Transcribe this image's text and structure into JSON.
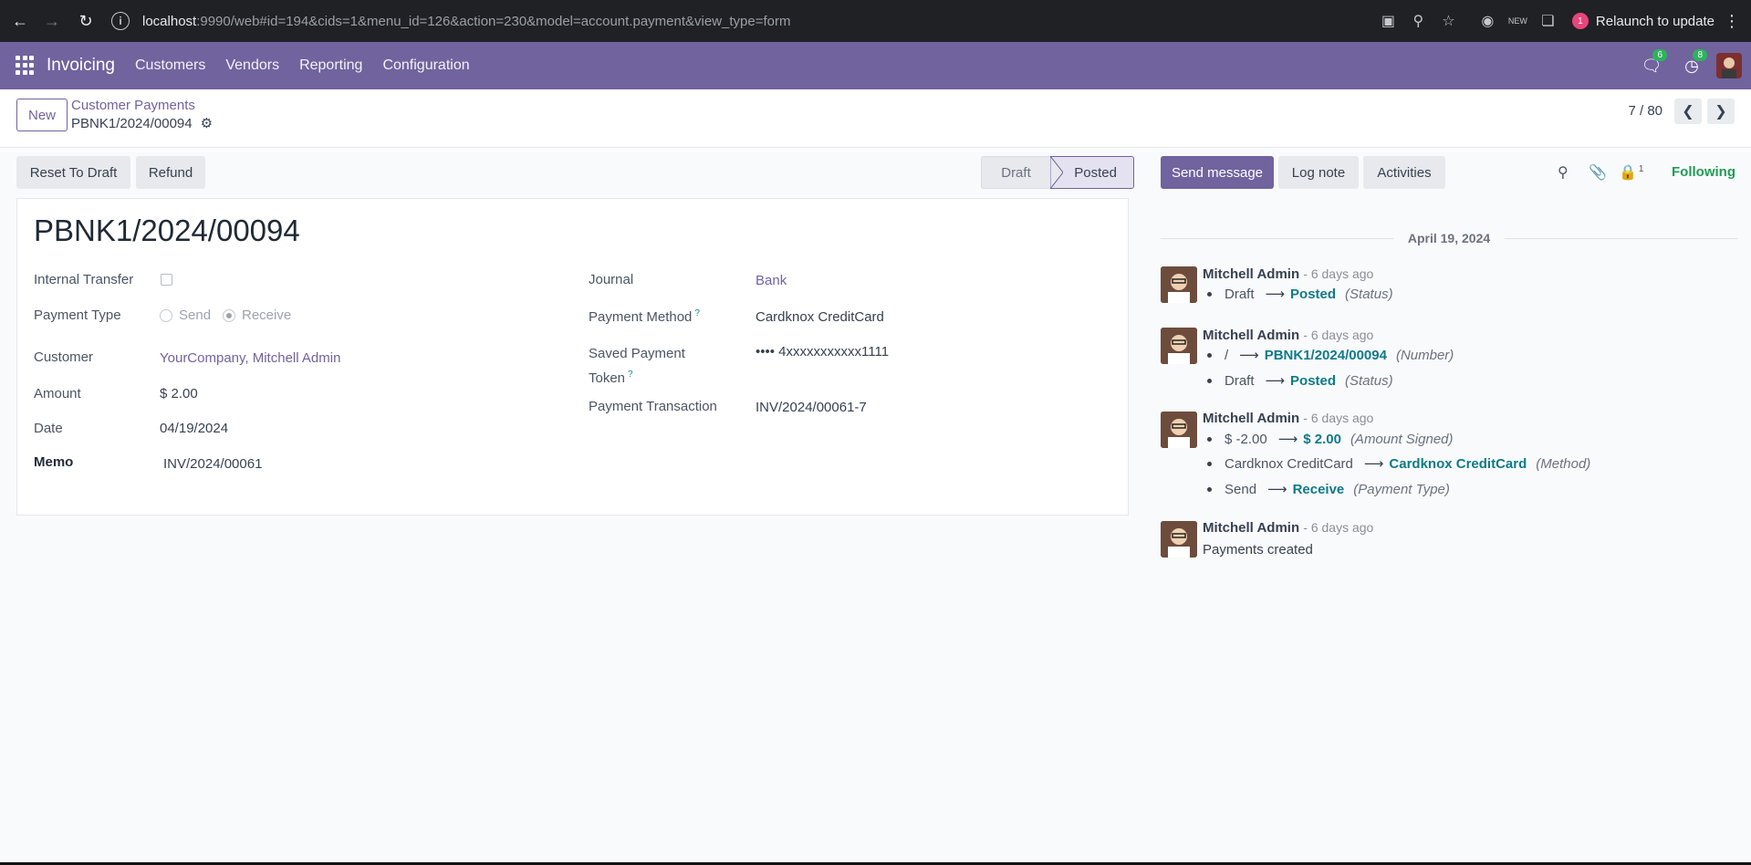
{
  "browser": {
    "url_host": "localhost",
    "url_rest": ":9990/web#id=194&cids=1&menu_id=126&action=230&model=account.payment&view_type=form",
    "relaunch_label": "Relaunch to update",
    "profile_badge": "1"
  },
  "topbar": {
    "app_title": "Invoicing",
    "menus": [
      "Customers",
      "Vendors",
      "Reporting",
      "Configuration"
    ],
    "messages_count": "6",
    "activities_count": "8"
  },
  "control": {
    "new_label": "New",
    "breadcrumb_parent": "Customer Payments",
    "breadcrumb_current": "PBNK1/2024/00094",
    "pager": "7 / 80"
  },
  "actions": {
    "reset_to_draft": "Reset To Draft",
    "refund": "Refund",
    "status_draft": "Draft",
    "status_posted": "Posted"
  },
  "form": {
    "title": "PBNK1/2024/00094",
    "internal_transfer_label": "Internal Transfer",
    "payment_type_label": "Payment Type",
    "payment_type_send": "Send",
    "payment_type_receive": "Receive",
    "customer_label": "Customer",
    "customer_value": "YourCompany, Mitchell Admin",
    "amount_label": "Amount",
    "amount_value": "$ 2.00",
    "date_label": "Date",
    "date_value": "04/19/2024",
    "memo_label": "Memo",
    "memo_value": "INV/2024/00061",
    "journal_label": "Journal",
    "journal_value": "Bank",
    "payment_method_label": "Payment Method",
    "payment_method_value": "Cardknox CreditCard",
    "saved_token_label_1": "Saved Payment",
    "saved_token_label_2": "Token",
    "saved_token_value": "•••• 4xxxxxxxxxxx1111",
    "transaction_label": "Payment Transaction",
    "transaction_value": "INV/2024/00061-7",
    "help_mark": "?"
  },
  "chatter": {
    "send_message": "Send message",
    "log_note": "Log note",
    "activities": "Activities",
    "followers_count": "1",
    "following": "Following",
    "date_separator": "April 19, 2024",
    "messages": [
      {
        "author": "Mitchell Admin",
        "ago": "- 6 days ago",
        "tracking": [
          {
            "old": "Draft",
            "new": "Posted",
            "field": "(Status)"
          }
        ]
      },
      {
        "author": "Mitchell Admin",
        "ago": "- 6 days ago",
        "tracking": [
          {
            "old": "/",
            "new": "PBNK1/2024/00094",
            "field": "(Number)"
          },
          {
            "old": "Draft",
            "new": "Posted",
            "field": "(Status)"
          }
        ]
      },
      {
        "author": "Mitchell Admin",
        "ago": "- 6 days ago",
        "tracking": [
          {
            "old": "$ -2.00",
            "new": "$ 2.00",
            "field": "(Amount Signed)"
          },
          {
            "old": "Cardknox CreditCard",
            "new": "Cardknox CreditCard",
            "field": "(Method)"
          },
          {
            "old": "Send",
            "new": "Receive",
            "field": "(Payment Type)"
          }
        ]
      },
      {
        "author": "Mitchell Admin",
        "ago": "- 6 days ago",
        "body": "Payments created"
      }
    ]
  },
  "colors": {
    "brand": "#71639e",
    "link_teal": "#0f7a8a",
    "following_green": "#1f9d55"
  }
}
